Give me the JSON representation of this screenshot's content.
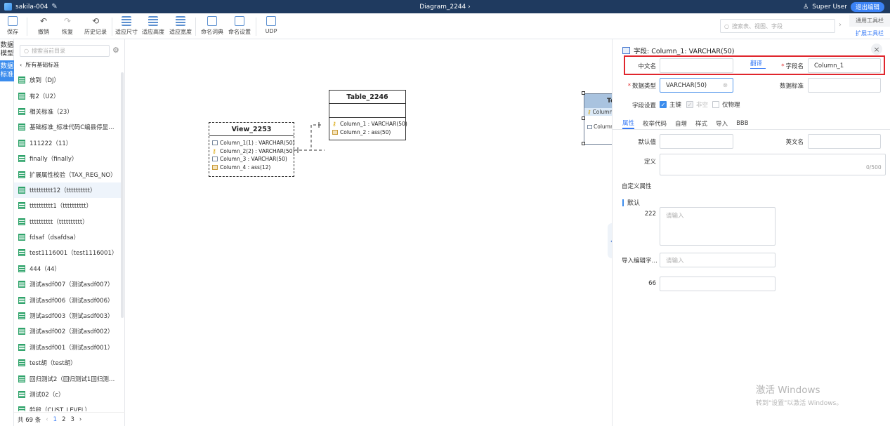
{
  "topbar": {
    "app_name": "sakila-004",
    "diagram_title": "Diagram_2244",
    "diagram_chevron": "›",
    "user_name": "Super User",
    "exit_label": "退出编辑"
  },
  "toolbar": {
    "save": "保存",
    "undo": "撤销",
    "redo": "恢复",
    "history": "历史记录",
    "fit_size": "适应尺寸",
    "fit_height": "适应高度",
    "fit_width": "适应宽度",
    "naming_dict": "命名词典",
    "naming_settings": "命名设置",
    "udp": "UDP",
    "search_placeholder": "搜索表、视图、字段",
    "general_toolbar": "通用工具栏",
    "ext_toolbar": "扩展工具栏"
  },
  "left_tabs": [
    {
      "label": "数据模型",
      "active": false
    },
    {
      "label": "数据标准",
      "active": true
    }
  ],
  "left_panel": {
    "search_placeholder": "搜索当前目录",
    "back_label": "所有基础标准",
    "items": [
      "放到（DJ）",
      "有2（U2）",
      "相关标准（23）",
      "基础标准_标准代码C编县停显…",
      "111222（11）",
      "finally（finally）",
      "扩展属性校验（TAX_REG_NO）",
      "tttttttttt12（tttttttttt）",
      "tttttttttt1（tttttttttt）",
      "tttttttttt（tttttttttt）",
      "fdsaf（dsafdsa）",
      "test1116001（test1116001）",
      "444（44）",
      "测试asdf007（测试asdf007）",
      "测试asdf006（测试asdf006）",
      "测试asdf003（测试asdf003）",
      "测试asdf002（测试asdf002）",
      "测试asdf001（测试asdf001）",
      "test胡（test胡）",
      "回归测试2（回归测试1回归测…",
      "测试02（c）",
      "龄段（CUST_LEVEL）"
    ],
    "selected_index": 7,
    "footer": {
      "total": "共 69 条",
      "prev": "‹",
      "pages": [
        "1",
        "2",
        "3"
      ],
      "next": "›"
    }
  },
  "canvas": {
    "view": {
      "title": "View_2253",
      "rows": [
        {
          "text": "Column_1(1) : VARCHAR(50)",
          "icon": "column"
        },
        {
          "text": "Column_2(2) : VARCHAR(50)",
          "icon": "key"
        },
        {
          "text": "Column_3 : VARCHAR(50)",
          "icon": "column"
        },
        {
          "text": "Column_4 : ass(12)",
          "icon": "ass"
        }
      ]
    },
    "table": {
      "title": "Table_2246",
      "rows": [
        {
          "text": "Column_1 : VARCHAR(50)",
          "icon": "key"
        },
        {
          "text": "Column_2 : ass(50)",
          "icon": "ass"
        }
      ]
    },
    "partial_table": {
      "title": "Te",
      "rows": [
        "Column",
        "Column"
      ]
    }
  },
  "field_panel": {
    "title": "字段: Column_1: VARCHAR(50)",
    "chinese_name_label": "中文名",
    "chinese_name_value": "",
    "translate": "翻译",
    "field_name_label": "字段名",
    "field_name_value": "Column_1",
    "data_type_label": "数据类型",
    "data_type_value": "VARCHAR(50)",
    "data_standard_label": "数据标准",
    "field_settings_label": "字段设置",
    "primary_key": "主键",
    "not_null": "非空",
    "physical_only": "仅物理",
    "tabs": [
      "属性",
      "枚举代码",
      "自增",
      "样式",
      "导入",
      "BBB"
    ],
    "default_label": "默认值",
    "english_name_label": "英文名",
    "definition_label": "定义",
    "definition_counter": "0/500",
    "custom_attrs": "自定义属性",
    "default_group": "默认",
    "attr_222_label": "222",
    "attr_222_placeholder": "请输入",
    "import_label": "导入编辑字…",
    "import_placeholder": "请输入",
    "attr_66_label": "66"
  },
  "watermark": {
    "line1": "激活 Windows",
    "line2": "转到\"设置\"以激活 Windows。"
  }
}
